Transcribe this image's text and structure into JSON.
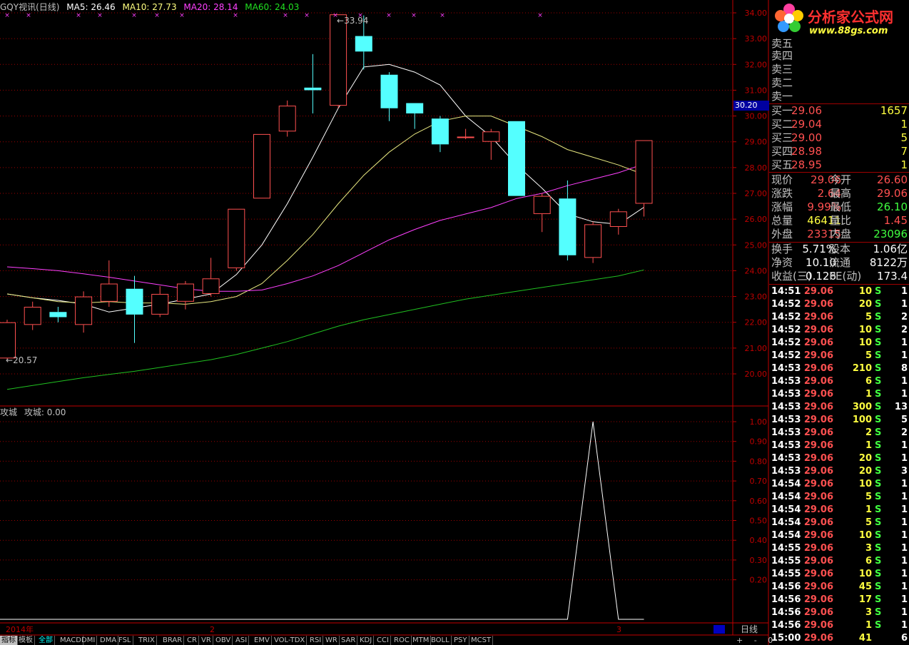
{
  "colors": {
    "up": "#ff5050",
    "down": "#54ffff",
    "ma5": "#ffffff",
    "ma10": "#e8e880",
    "ma20": "#ff40ff",
    "ma60": "#20c020",
    "grid": "#a00000",
    "axis": "#c00000"
  },
  "header": {
    "title": "GQY视讯(日线)",
    "ma5": "MA5: 26.46",
    "ma10": "MA10: 27.73",
    "ma20": "MA20: 28.14",
    "ma60": "MA60: 24.03"
  },
  "logo": {
    "name": "分析家公式网",
    "url": "www.88gs.com"
  },
  "indicator": {
    "label": "攻城",
    "value_label": "攻城: 0.00"
  },
  "annotations": {
    "high": "33.94",
    "low": "20.57",
    "current_price_tag": "30.20"
  },
  "x_labels": [
    "2014年",
    "2",
    "3"
  ],
  "timeframe": "日线",
  "chart_data": [
    {
      "type": "candlestick",
      "title": "GQY视讯(日线)",
      "ylim": [
        19.0,
        34.0
      ],
      "yticks": [
        "34.00",
        "33.00",
        "32.00",
        "31.00",
        "30.00",
        "29.00",
        "28.00",
        "27.00",
        "26.00",
        "25.00",
        "24.00",
        "23.00",
        "22.00",
        "21.00",
        "20.00"
      ],
      "candles": [
        {
          "o": 20.6,
          "c": 22.0,
          "h": 22.1,
          "l": 20.57
        },
        {
          "o": 21.9,
          "c": 22.6,
          "h": 22.8,
          "l": 21.7
        },
        {
          "o": 22.4,
          "c": 22.2,
          "h": 22.6,
          "l": 22.0
        },
        {
          "o": 21.9,
          "c": 23.0,
          "h": 23.2,
          "l": 21.6
        },
        {
          "o": 22.8,
          "c": 23.5,
          "h": 24.4,
          "l": 22.6
        },
        {
          "o": 23.3,
          "c": 22.3,
          "h": 23.8,
          "l": 21.2
        },
        {
          "o": 22.3,
          "c": 23.1,
          "h": 23.4,
          "l": 22.2
        },
        {
          "o": 22.8,
          "c": 23.5,
          "h": 23.6,
          "l": 22.5
        },
        {
          "o": 23.1,
          "c": 23.7,
          "h": 24.5,
          "l": 23.0
        },
        {
          "o": 24.1,
          "c": 26.4,
          "h": 26.4,
          "l": 24.0
        },
        {
          "o": 26.8,
          "c": 29.3,
          "h": 29.3,
          "l": 26.8
        },
        {
          "o": 29.4,
          "c": 30.4,
          "h": 30.6,
          "l": 29.2
        },
        {
          "o": 31.1,
          "c": 31.0,
          "h": 32.4,
          "l": 30.1
        },
        {
          "o": 30.4,
          "c": 33.94,
          "h": 33.94,
          "l": 30.3
        },
        {
          "o": 33.1,
          "c": 32.5,
          "h": 33.9,
          "l": 31.8
        },
        {
          "o": 31.6,
          "c": 30.3,
          "h": 31.7,
          "l": 29.8
        },
        {
          "o": 30.5,
          "c": 30.1,
          "h": 30.5,
          "l": 29.5
        },
        {
          "o": 29.9,
          "c": 28.9,
          "h": 30.0,
          "l": 28.6
        },
        {
          "o": 29.2,
          "c": 29.2,
          "h": 29.5,
          "l": 29.1
        },
        {
          "o": 29.0,
          "c": 29.4,
          "h": 29.5,
          "l": 28.3
        },
        {
          "o": 29.8,
          "c": 26.9,
          "h": 29.8,
          "l": 26.9
        },
        {
          "o": 26.2,
          "c": 26.9,
          "h": 27.0,
          "l": 25.5
        },
        {
          "o": 26.8,
          "c": 24.6,
          "h": 27.5,
          "l": 24.4
        },
        {
          "o": 24.5,
          "c": 25.8,
          "h": 25.9,
          "l": 24.3
        },
        {
          "o": 25.7,
          "c": 26.3,
          "h": 26.4,
          "l": 25.4
        },
        {
          "o": 26.6,
          "c": 29.06,
          "h": 29.06,
          "l": 26.1
        }
      ],
      "series": [
        {
          "name": "MA5",
          "values": [
            23.1,
            22.95,
            22.85,
            22.7,
            22.4,
            22.55,
            22.7,
            22.9,
            23.1,
            23.85,
            25.0,
            26.6,
            28.4,
            30.3,
            31.9,
            32.0,
            31.7,
            31.2,
            30.0,
            29.2,
            28.1,
            27.2,
            26.2,
            25.9,
            25.8,
            26.46
          ]
        },
        {
          "name": "MA10",
          "values": [
            23.1,
            22.95,
            22.8,
            22.75,
            22.8,
            22.75,
            22.75,
            22.7,
            22.8,
            23.0,
            23.5,
            24.4,
            25.4,
            26.6,
            27.7,
            28.6,
            29.3,
            29.8,
            30.0,
            30.0,
            29.6,
            29.2,
            28.7,
            28.4,
            28.1,
            27.73
          ]
        },
        {
          "name": "MA20",
          "values": [
            24.15,
            24.08,
            24.0,
            23.88,
            23.75,
            23.6,
            23.45,
            23.3,
            23.2,
            23.2,
            23.25,
            23.5,
            23.8,
            24.2,
            24.7,
            25.2,
            25.6,
            25.95,
            26.2,
            26.45,
            26.8,
            27.0,
            27.3,
            27.55,
            27.8,
            28.14
          ]
        },
        {
          "name": "MA60",
          "values": [
            19.4,
            19.55,
            19.7,
            19.85,
            19.98,
            20.1,
            20.25,
            20.4,
            20.55,
            20.75,
            21.0,
            21.25,
            21.55,
            21.85,
            22.1,
            22.3,
            22.5,
            22.7,
            22.9,
            23.05,
            23.2,
            23.35,
            23.5,
            23.65,
            23.8,
            24.03
          ]
        }
      ]
    },
    {
      "type": "line",
      "title": "攻城",
      "ylim": [
        0.0,
        1.0
      ],
      "yticks": [
        "1.00",
        "0.90",
        "0.80",
        "0.70",
        "0.60",
        "0.50",
        "0.40",
        "0.30",
        "0.20"
      ],
      "series": [
        {
          "name": "攻城",
          "values": [
            0,
            0,
            0,
            0,
            0,
            0,
            0,
            0,
            0,
            0,
            0,
            0,
            0,
            0,
            0,
            0,
            0,
            0,
            0,
            0,
            0,
            0,
            0,
            1.0,
            0,
            0
          ]
        }
      ]
    }
  ],
  "panel": {
    "sells": [
      "卖五",
      "卖四",
      "卖三",
      "卖二",
      "卖一"
    ],
    "buys": [
      {
        "label": "买一",
        "price": "29.06",
        "vol": "1657"
      },
      {
        "label": "买二",
        "price": "29.04",
        "vol": "1"
      },
      {
        "label": "买三",
        "price": "29.00",
        "vol": "5"
      },
      {
        "label": "买四",
        "price": "28.98",
        "vol": "7"
      },
      {
        "label": "买五",
        "price": "28.95",
        "vol": "1"
      }
    ],
    "stats": [
      {
        "l1": "现价",
        "v1": "29.06",
        "l2": "今开",
        "v2": "26.60",
        "c1": "red",
        "c2": "red"
      },
      {
        "l1": "涨跌",
        "v1": "2.64",
        "l2": "最高",
        "v2": "29.06",
        "c1": "red",
        "c2": "red"
      },
      {
        "l1": "涨幅",
        "v1": "9.99%",
        "l2": "最低",
        "v2": "26.10",
        "c1": "red",
        "c2": "grn"
      },
      {
        "l1": "总量",
        "v1": "46411",
        "l2": "量比",
        "v2": "1.45",
        "c1": "yel",
        "c2": "red"
      },
      {
        "l1": "外盘",
        "v1": "23315",
        "l2": "内盘",
        "v2": "23096",
        "c1": "red",
        "c2": "grn"
      }
    ],
    "stats2": [
      {
        "l1": "换手",
        "v1": "5.71%",
        "l2": "股本",
        "v2": "1.06亿"
      },
      {
        "l1": "净资",
        "v1": "10.10",
        "l2": "流通",
        "v2": "8122万"
      },
      {
        "l1": "收益(三)",
        "v1": "0.126",
        "l2": "PE(动)",
        "v2": "173.4"
      }
    ],
    "ticks": [
      {
        "t": "14:51",
        "p": "29.06",
        "v": "10",
        "f": "S",
        "n": "1"
      },
      {
        "t": "14:52",
        "p": "29.06",
        "v": "20",
        "f": "S",
        "n": "1"
      },
      {
        "t": "14:52",
        "p": "29.06",
        "v": "5",
        "f": "S",
        "n": "2"
      },
      {
        "t": "14:52",
        "p": "29.06",
        "v": "10",
        "f": "S",
        "n": "2"
      },
      {
        "t": "14:52",
        "p": "29.06",
        "v": "10",
        "f": "S",
        "n": "1"
      },
      {
        "t": "14:52",
        "p": "29.06",
        "v": "5",
        "f": "S",
        "n": "1"
      },
      {
        "t": "14:53",
        "p": "29.06",
        "v": "210",
        "f": "S",
        "n": "8"
      },
      {
        "t": "14:53",
        "p": "29.06",
        "v": "6",
        "f": "S",
        "n": "1"
      },
      {
        "t": "14:53",
        "p": "29.06",
        "v": "1",
        "f": "S",
        "n": "1"
      },
      {
        "t": "14:53",
        "p": "29.06",
        "v": "300",
        "f": "S",
        "n": "13"
      },
      {
        "t": "14:53",
        "p": "29.06",
        "v": "100",
        "f": "S",
        "n": "5"
      },
      {
        "t": "14:53",
        "p": "29.06",
        "v": "2",
        "f": "S",
        "n": "2"
      },
      {
        "t": "14:53",
        "p": "29.06",
        "v": "1",
        "f": "S",
        "n": "1"
      },
      {
        "t": "14:53",
        "p": "29.06",
        "v": "20",
        "f": "S",
        "n": "1"
      },
      {
        "t": "14:53",
        "p": "29.06",
        "v": "20",
        "f": "S",
        "n": "3"
      },
      {
        "t": "14:54",
        "p": "29.06",
        "v": "10",
        "f": "S",
        "n": "1"
      },
      {
        "t": "14:54",
        "p": "29.06",
        "v": "5",
        "f": "S",
        "n": "1"
      },
      {
        "t": "14:54",
        "p": "29.06",
        "v": "1",
        "f": "S",
        "n": "1"
      },
      {
        "t": "14:54",
        "p": "29.06",
        "v": "5",
        "f": "S",
        "n": "1"
      },
      {
        "t": "14:54",
        "p": "29.06",
        "v": "10",
        "f": "S",
        "n": "1"
      },
      {
        "t": "14:55",
        "p": "29.06",
        "v": "3",
        "f": "S",
        "n": "1"
      },
      {
        "t": "14:55",
        "p": "29.06",
        "v": "6",
        "f": "S",
        "n": "1"
      },
      {
        "t": "14:55",
        "p": "29.06",
        "v": "10",
        "f": "S",
        "n": "1"
      },
      {
        "t": "14:56",
        "p": "29.06",
        "v": "45",
        "f": "S",
        "n": "1"
      },
      {
        "t": "14:56",
        "p": "29.06",
        "v": "17",
        "f": "S",
        "n": "1"
      },
      {
        "t": "14:56",
        "p": "29.06",
        "v": "3",
        "f": "S",
        "n": "1"
      },
      {
        "t": "14:56",
        "p": "29.06",
        "v": "1",
        "f": "S",
        "n": "1"
      },
      {
        "t": "15:00",
        "p": "29.06",
        "v": "41",
        "f": "",
        "n": "6"
      }
    ]
  },
  "tabs": [
    "指标",
    "模板",
    "全部",
    "MACD",
    "DMI",
    "DMA",
    "FSL",
    "TRIX",
    "BRAR",
    "CR",
    "VR",
    "OBV",
    "ASI",
    "EMV",
    "VOL-TDX",
    "RSI",
    "WR",
    "SAR",
    "KDJ",
    "CCI",
    "ROC",
    "MTM",
    "BOLL",
    "PSY",
    "MCST"
  ],
  "footer_controls": [
    "+",
    "-",
    "0"
  ]
}
